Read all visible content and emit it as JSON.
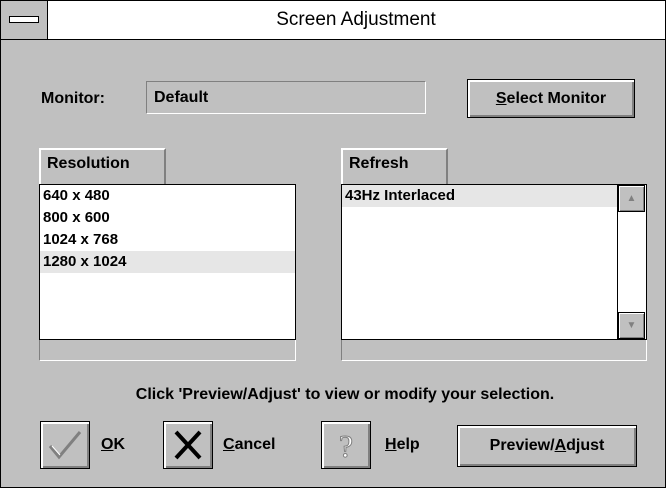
{
  "window": {
    "title": "Screen Adjustment"
  },
  "monitor": {
    "label": "Monitor:",
    "value": "Default",
    "select_button": {
      "accel": "S",
      "rest": "elect Monitor"
    }
  },
  "resolution": {
    "tab_label": "Resolution",
    "items": [
      "640 x 480",
      "800 x 600",
      "1024 x 768",
      "1280 x 1024"
    ],
    "selected_index": 3
  },
  "refresh": {
    "tab_label": "Refresh",
    "items": [
      "43Hz Interlaced"
    ],
    "scroll_up": "▲",
    "scroll_down": "▼"
  },
  "hint": "Click 'Preview/Adjust' to view or modify your selection.",
  "buttons": {
    "ok": {
      "accel": "O",
      "rest": "K"
    },
    "cancel": {
      "accel": "C",
      "rest": "ancel"
    },
    "help": {
      "accel": "H",
      "rest": "elp"
    },
    "preview": {
      "pre": "Preview/",
      "accel": "A",
      "rest": "djust"
    }
  },
  "icons": {
    "ok": "checkmark-icon",
    "cancel": "x-icon",
    "help": "question-icon"
  },
  "colors": {
    "face": "#c0c0c0",
    "shadow": "#808080",
    "highlight": "#ffffff",
    "frame": "#000000"
  }
}
